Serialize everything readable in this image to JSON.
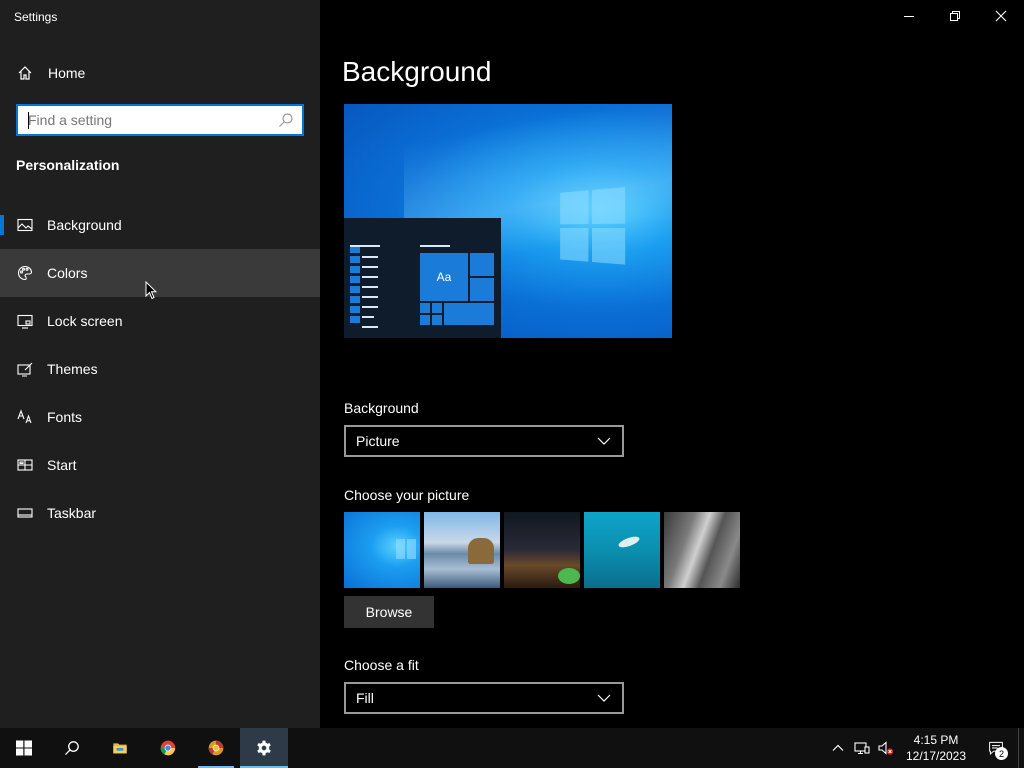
{
  "window": {
    "app_title": "Settings",
    "controls": {
      "minimize": "minimize-icon",
      "restore": "restore-icon",
      "close": "close-icon"
    }
  },
  "sidebar": {
    "home_label": "Home",
    "search_placeholder": "Find a setting",
    "search_value": "",
    "section_title": "Personalization",
    "items": [
      {
        "label": "Background",
        "icon": "picture-icon",
        "active": true
      },
      {
        "label": "Colors",
        "icon": "palette-icon",
        "hover": true
      },
      {
        "label": "Lock screen",
        "icon": "lock-screen-icon"
      },
      {
        "label": "Themes",
        "icon": "themes-icon"
      },
      {
        "label": "Fonts",
        "icon": "fonts-icon"
      },
      {
        "label": "Start",
        "icon": "start-icon"
      },
      {
        "label": "Taskbar",
        "icon": "taskbar-icon"
      }
    ]
  },
  "main": {
    "page_title": "Background",
    "preview": {
      "tile_label": "Aa"
    },
    "background_label": "Background",
    "background_value": "Picture",
    "choose_picture_label": "Choose your picture",
    "browse_label": "Browse",
    "fit_label": "Choose a fit",
    "fit_value": "Fill"
  },
  "taskbar": {
    "buttons": [
      {
        "icon": "windows-start-icon"
      },
      {
        "icon": "search-icon"
      },
      {
        "icon": "file-explorer-icon"
      },
      {
        "icon": "chrome-icon"
      },
      {
        "icon": "chrome-canary-icon",
        "running": true
      },
      {
        "icon": "settings-gear-icon",
        "running": true,
        "active": true
      }
    ],
    "tray": {
      "time": "4:15 PM",
      "date": "12/17/2023",
      "notification_count": "2"
    }
  },
  "colors": {
    "accent": "#0078d7",
    "sidebar_bg": "#1f1f1f",
    "main_bg": "#000000",
    "taskbar_bg": "#101010"
  }
}
